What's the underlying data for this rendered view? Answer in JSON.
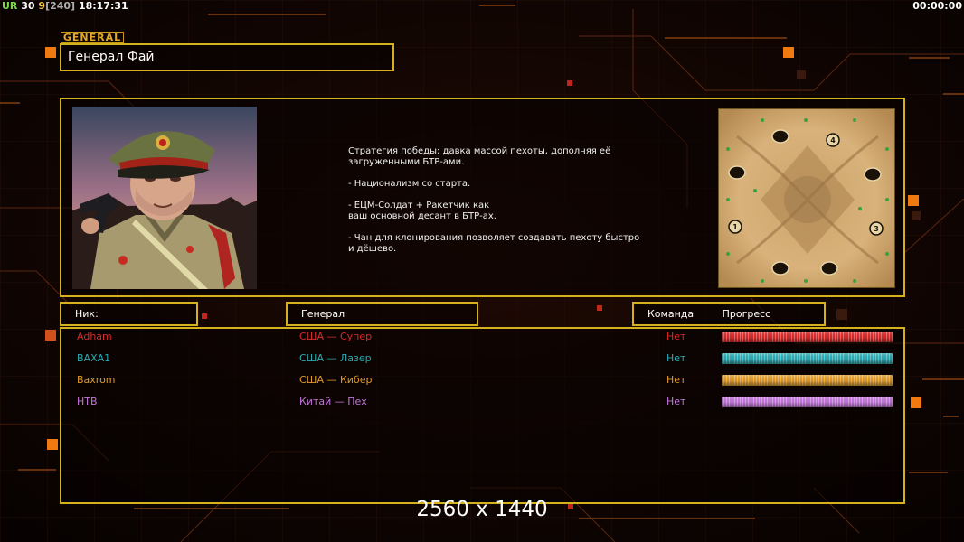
{
  "hud": {
    "left_prefix": "UR",
    "left_fps": "30",
    "left_q": "9",
    "left_bracket": "[240]",
    "left_time": "18:17:31",
    "right_timer": "00:00:00"
  },
  "general": {
    "tag": "GENERAL",
    "name": "Генерал Фай",
    "description": [
      "Стратегия победы: давка массой пехоты, дополняя её\n загруженными БТР-ами.",
      "- Национализм со старта.",
      "- ЕЦМ-Солдат + Ракетчик как\nваш основной десант в БТР-ах.",
      "- Чан для клонирования позволяет создавать пехоту быстро\n и дёшево."
    ],
    "portrait_icon": "general-portrait",
    "map_icon": "map-preview",
    "map_spawns": [
      "1",
      "3",
      "4"
    ]
  },
  "headers": {
    "nick": "Ник:",
    "general": "Генерал",
    "team": "Команда",
    "progress": "Прогресс"
  },
  "players": [
    {
      "nick": "Adham",
      "general": "США — Супер",
      "team": "Нет",
      "color": "#d92a2a",
      "progress": 1.0
    },
    {
      "nick": "BAXA1",
      "general": "США — Лазер",
      "team": "Нет",
      "color": "#2aa9b2",
      "progress": 1.0
    },
    {
      "nick": "Baxrom",
      "general": "США — Кибер",
      "team": "Нет",
      "color": "#e09a28",
      "progress": 1.0
    },
    {
      "nick": "HTB",
      "general": "Китай — Пех",
      "team": "Нет",
      "color": "#c276d9",
      "progress": 1.0
    }
  ],
  "watermark": "2560 x 1440"
}
